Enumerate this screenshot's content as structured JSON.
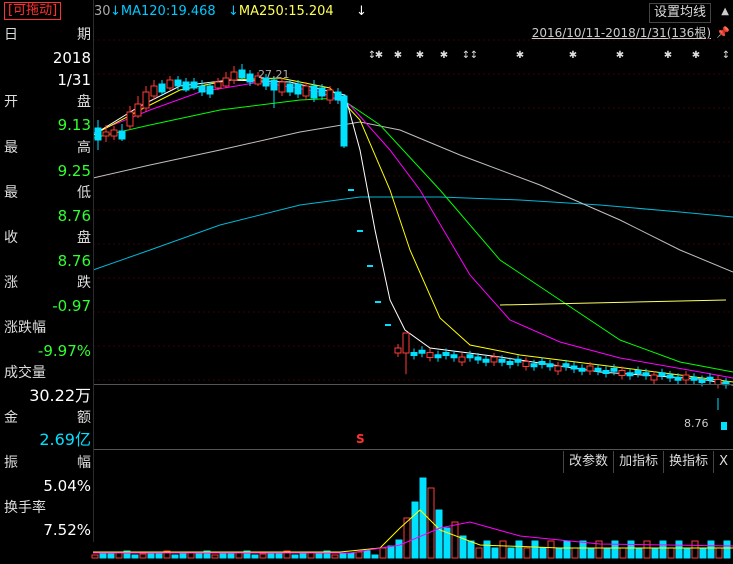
{
  "indicators": {
    "cut_value": "30",
    "ma120": "MA120:19.468",
    "ma250": "MA250:15.204",
    "ma120_color": "#00c8ff",
    "ma250_color": "#ffff50"
  },
  "header": {
    "settings_label": "设置均线",
    "date_range": "2016/10/11-2018/1/31(136根)"
  },
  "panel": {
    "draggable_tag": "[可拖动]",
    "date_label": [
      "日",
      "期"
    ],
    "year": "2018",
    "date": "1/31",
    "open_label": [
      "开",
      "盘"
    ],
    "open": "9.13",
    "high_label": [
      "最",
      "高"
    ],
    "high": "9.25",
    "low_label": [
      "最",
      "低"
    ],
    "low": "8.76",
    "close_label": [
      "收",
      "盘"
    ],
    "close": "8.76",
    "change_label": [
      "涨",
      "跌"
    ],
    "change": "-0.97",
    "change_pct_label": "涨跌幅",
    "change_pct": "-9.97%",
    "volume_label": "成交量",
    "volume": "30.22万",
    "amount_label": [
      "金",
      "额"
    ],
    "amount": "2.69亿",
    "amplitude_label": [
      "振",
      "幅"
    ],
    "amplitude": "5.04%",
    "turnover_label": "换手率",
    "turnover": "7.52%"
  },
  "chart": {
    "high_annotation": "27.21",
    "low_annotation": "8.76",
    "signal_mark": "S",
    "colors": {
      "up": "#ff3c3c",
      "down": "#00e0ff",
      "ma5": "#ffffff",
      "ma10": "#ffff00",
      "ma20": "#ff00ff",
      "ma60": "#00ff00",
      "ma120": "#c0c0c0",
      "ma250": "#00b8d8"
    }
  },
  "volume_toolbar": {
    "change_params": "改参数",
    "add_indicator": "加指标",
    "switch_indicator": "换指标",
    "close": "X"
  }
}
